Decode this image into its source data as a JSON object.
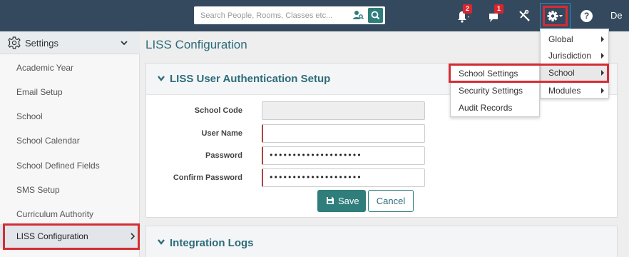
{
  "topbar": {
    "search_placeholder": "Search People, Rooms, Classes etc...",
    "notifications_badge": "2",
    "messages_badge": "1",
    "user_name_partial": "De",
    "help_label": "?"
  },
  "sidebar": {
    "title": "Settings",
    "items": [
      {
        "label": "Academic Year"
      },
      {
        "label": "Email Setup"
      },
      {
        "label": "School"
      },
      {
        "label": "School Calendar"
      },
      {
        "label": "School Defined Fields"
      },
      {
        "label": "SMS Setup"
      },
      {
        "label": "Curriculum Authority"
      },
      {
        "label": "LISS Configuration"
      }
    ],
    "active_item": "LISS Configuration"
  },
  "main": {
    "page_title": "LISS Configuration",
    "auth_panel": {
      "title": "LISS User Authentication Setup",
      "fields": [
        {
          "label": "School Code",
          "value": ""
        },
        {
          "label": "User Name",
          "value": ""
        },
        {
          "label": "Password",
          "value": "••••••••••••••••••••"
        },
        {
          "label": "Confirm Password",
          "value": "••••••••••••••••••••"
        }
      ],
      "save_label": "Save",
      "cancel_label": "Cancel"
    },
    "logs_panel": {
      "title": "Integration Logs"
    }
  },
  "settings_menu": {
    "items": [
      {
        "label": "Global"
      },
      {
        "label": "Jurisdiction"
      },
      {
        "label": "School"
      },
      {
        "label": "Modules"
      }
    ],
    "school_submenu": [
      {
        "label": "School Settings"
      },
      {
        "label": "Security Settings"
      },
      {
        "label": "Audit Records"
      }
    ]
  },
  "colors": {
    "topbar": "#34495e",
    "accent_teal": "#2f7e7c",
    "highlight_red": "#d42d35",
    "badge_red": "#d9262e",
    "title_teal": "#2d6c7a"
  }
}
